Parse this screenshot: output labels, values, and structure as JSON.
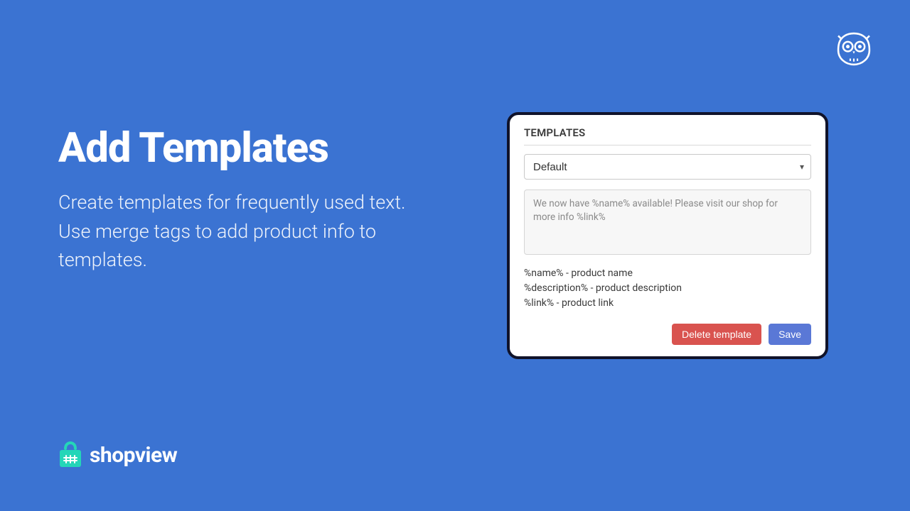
{
  "hero": {
    "title": "Add Templates",
    "subtitle": "Create templates for frequently used text. Use merge tags to add product info to templates."
  },
  "brand": {
    "name": "shopview"
  },
  "panel": {
    "title": "TEMPLATES",
    "select": {
      "selected": "Default"
    },
    "textarea_value": "We now have %name% available! Please visit our shop for more info %link%",
    "legend": {
      "line1": "%name% - product name",
      "line2": "%description% - product description",
      "line3": "%link% - product link"
    },
    "buttons": {
      "delete": "Delete template",
      "save": "Save"
    }
  }
}
